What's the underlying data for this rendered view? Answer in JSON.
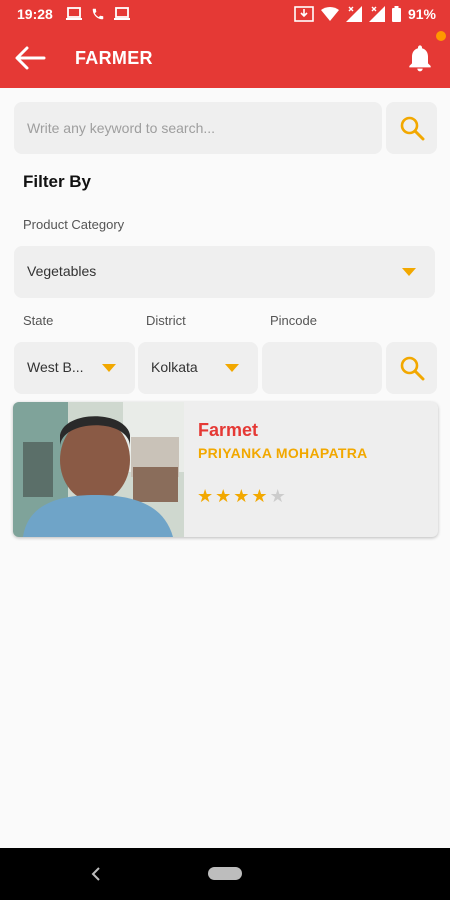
{
  "status": {
    "time": "19:28",
    "battery": "91%"
  },
  "appbar": {
    "title": "FARMER",
    "has_notification": true
  },
  "search": {
    "placeholder": "Write any keyword to search...",
    "value": ""
  },
  "filter": {
    "title": "Filter By",
    "product_category_label": "Product Category",
    "product_category_value": "Vegetables",
    "state_label": "State",
    "state_value": "West B...",
    "district_label": "District",
    "district_value": "Kolkata",
    "pincode_label": "Pincode",
    "pincode_value": ""
  },
  "results": [
    {
      "name": "Farmet",
      "owner": "PRIYANKA MOHAPATRA",
      "rating": 4,
      "max_rating": 5
    }
  ],
  "colors": {
    "primary": "#e53935",
    "accent": "#f2a800",
    "field_bg": "#efefef",
    "star_empty": "#cccccc"
  }
}
